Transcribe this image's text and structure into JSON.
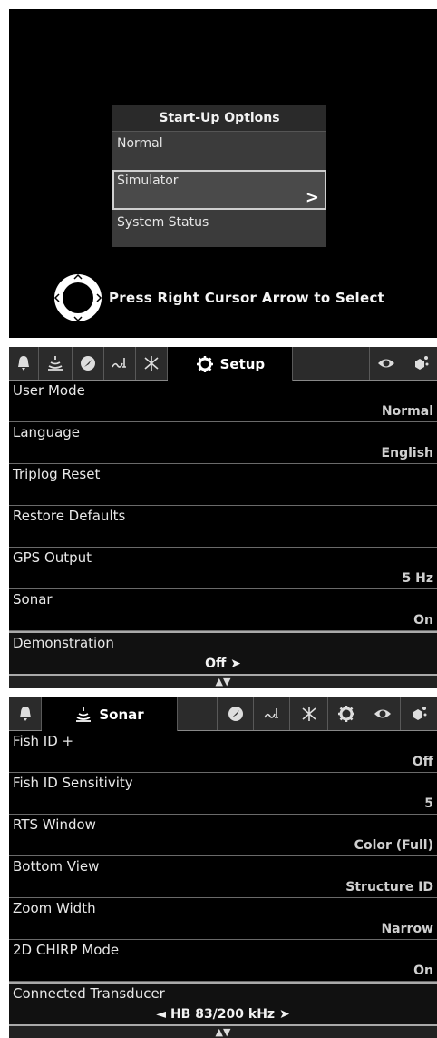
{
  "startup": {
    "title": "Start-Up Options",
    "options": [
      "Normal",
      "Simulator",
      "System Status"
    ],
    "selected_arrow": ">",
    "hint": "Press Right Cursor Arrow to Select"
  },
  "setup_menu": {
    "active_tab": "Setup",
    "rows": [
      {
        "label": "User Mode",
        "value": "Normal"
      },
      {
        "label": "Language",
        "value": "English"
      },
      {
        "label": "Triplog Reset",
        "value": ""
      },
      {
        "label": "Restore Defaults",
        "value": ""
      },
      {
        "label": "GPS Output",
        "value": "5 Hz"
      },
      {
        "label": "Sonar",
        "value": "On"
      },
      {
        "label": "Demonstration",
        "value": "Off ➤"
      }
    ],
    "scroll_glyph": "▲▼"
  },
  "sonar_menu": {
    "active_tab": "Sonar",
    "rows": [
      {
        "label": "Fish ID +",
        "value": "Off"
      },
      {
        "label": "Fish ID Sensitivity",
        "value": "5"
      },
      {
        "label": "RTS Window",
        "value": "Color (Full)"
      },
      {
        "label": "Bottom View",
        "value": "Structure ID"
      },
      {
        "label": "Zoom Width",
        "value": "Narrow"
      },
      {
        "label": "2D CHIRP Mode",
        "value": "On"
      },
      {
        "label": "Connected Transducer",
        "value": "◄ HB 83/200 kHz ➤"
      }
    ],
    "scroll_glyph": "▲▼"
  },
  "colors": {
    "panel_bg": "#000000",
    "tab_bg": "#2b2b2b",
    "text": "#e8e8e8"
  }
}
